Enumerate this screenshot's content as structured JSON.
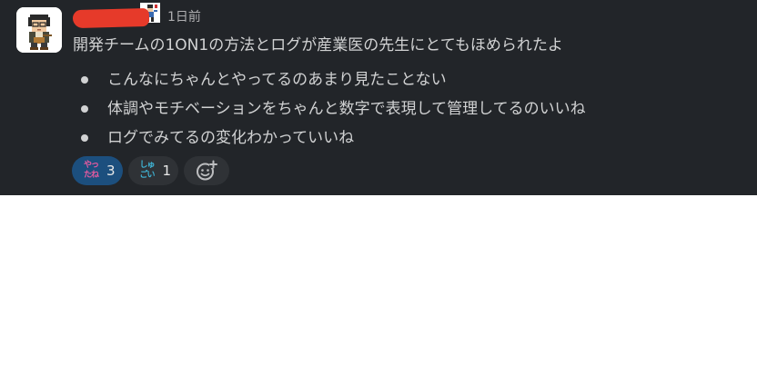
{
  "message": {
    "timestamp": "1日前",
    "text": "開発チームの1ON1の方法とログが産業医の先生にとてもほめられたよ",
    "bullets": [
      "こんなにちゃんとやってるのあまり見たことない",
      "体調やモチベーションをちゃんと数字で表現して管理してるのいいね",
      "ログでみてるの変化わかっていいね"
    ]
  },
  "reactions": [
    {
      "emoji_line1": "やっ",
      "emoji_line2": "たね",
      "count": "3",
      "emoji_color": "#e85aa0",
      "active": true
    },
    {
      "emoji_line1": "しゅ",
      "emoji_line2": "ごい",
      "count": "1",
      "emoji_color": "#3fb5d6",
      "active": false
    }
  ],
  "icons": {
    "add_reaction": "add-reaction-icon",
    "avatar": "pixel-avatar",
    "status_emoji": "status-emoji-icon"
  },
  "colors": {
    "background": "#222529",
    "text": "#d1d2d3",
    "active_reaction": "#1c4f7e",
    "reaction": "#2f3236"
  }
}
